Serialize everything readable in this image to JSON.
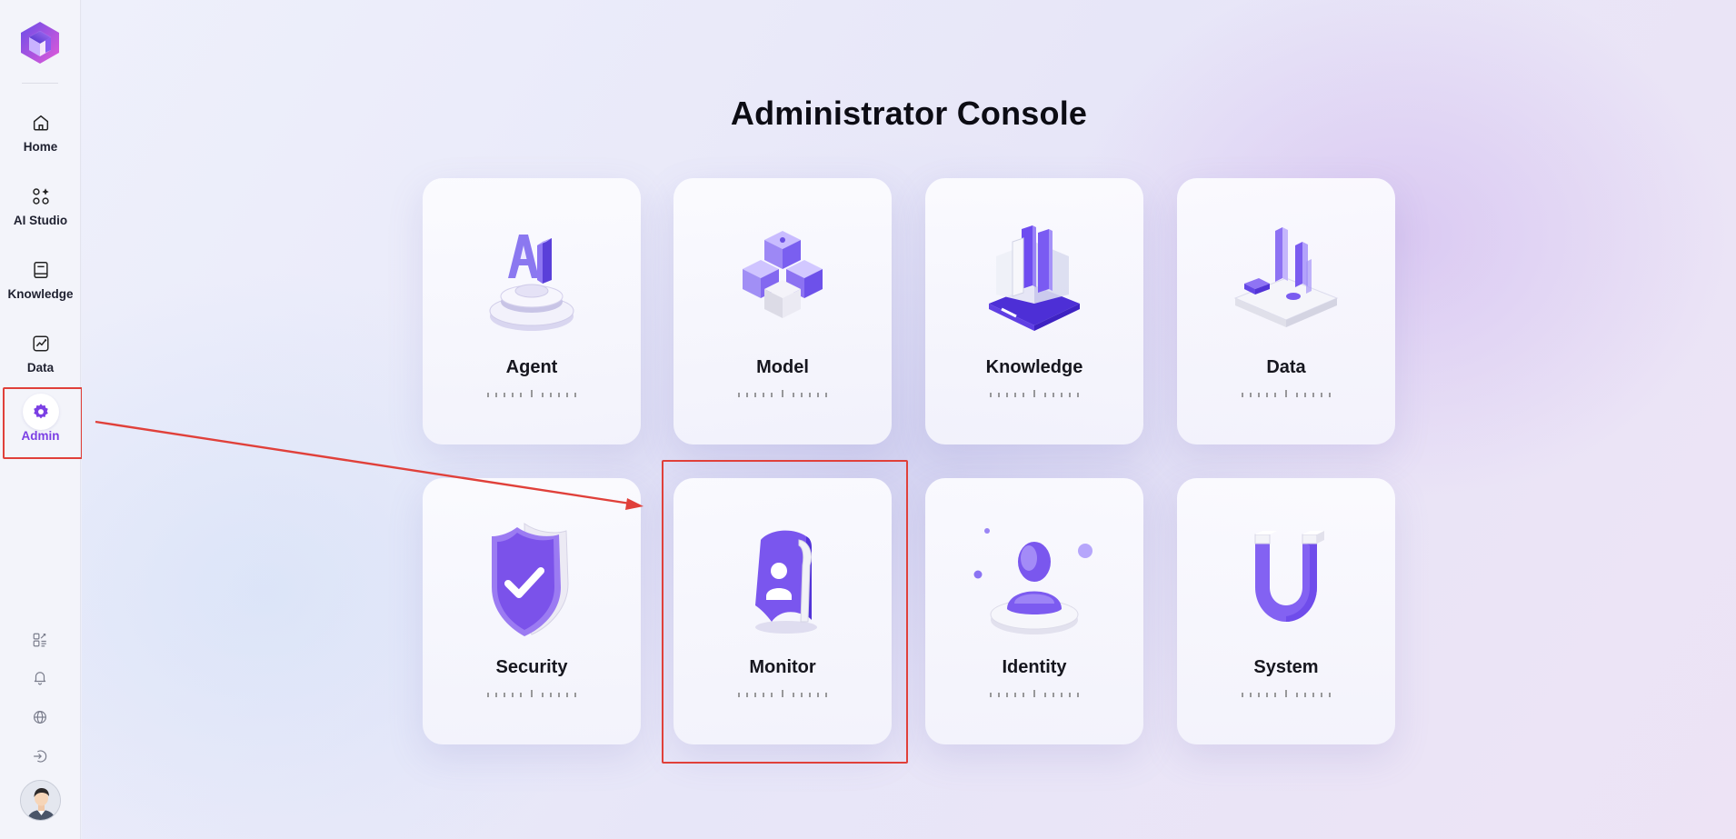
{
  "sidebar": {
    "nav": [
      {
        "label": "Home",
        "icon": "home-icon"
      },
      {
        "label": "AI Studio",
        "icon": "ai-studio-icon"
      },
      {
        "label": "Knowledge",
        "icon": "book-icon"
      },
      {
        "label": "Data",
        "icon": "chart-icon"
      },
      {
        "label": "Admin",
        "icon": "gear-icon",
        "active": true
      }
    ],
    "bottom_icons": [
      "apps-icon",
      "bell-icon",
      "globe-icon",
      "logout-icon"
    ],
    "accent_color": "#7b3fe4"
  },
  "page": {
    "title": "Administrator Console"
  },
  "cards": [
    {
      "label": "Agent",
      "icon": "agent-illustration"
    },
    {
      "label": "Model",
      "icon": "model-cubes-illustration"
    },
    {
      "label": "Knowledge",
      "icon": "knowledge-books-illustration"
    },
    {
      "label": "Data",
      "icon": "data-bars-illustration"
    },
    {
      "label": "Security",
      "icon": "shield-check-illustration"
    },
    {
      "label": "Monitor",
      "icon": "monitor-badge-illustration"
    },
    {
      "label": "Identity",
      "icon": "identity-user-illustration"
    },
    {
      "label": "System",
      "icon": "magnet-illustration"
    }
  ],
  "annotations": {
    "color": "#e0403a"
  }
}
